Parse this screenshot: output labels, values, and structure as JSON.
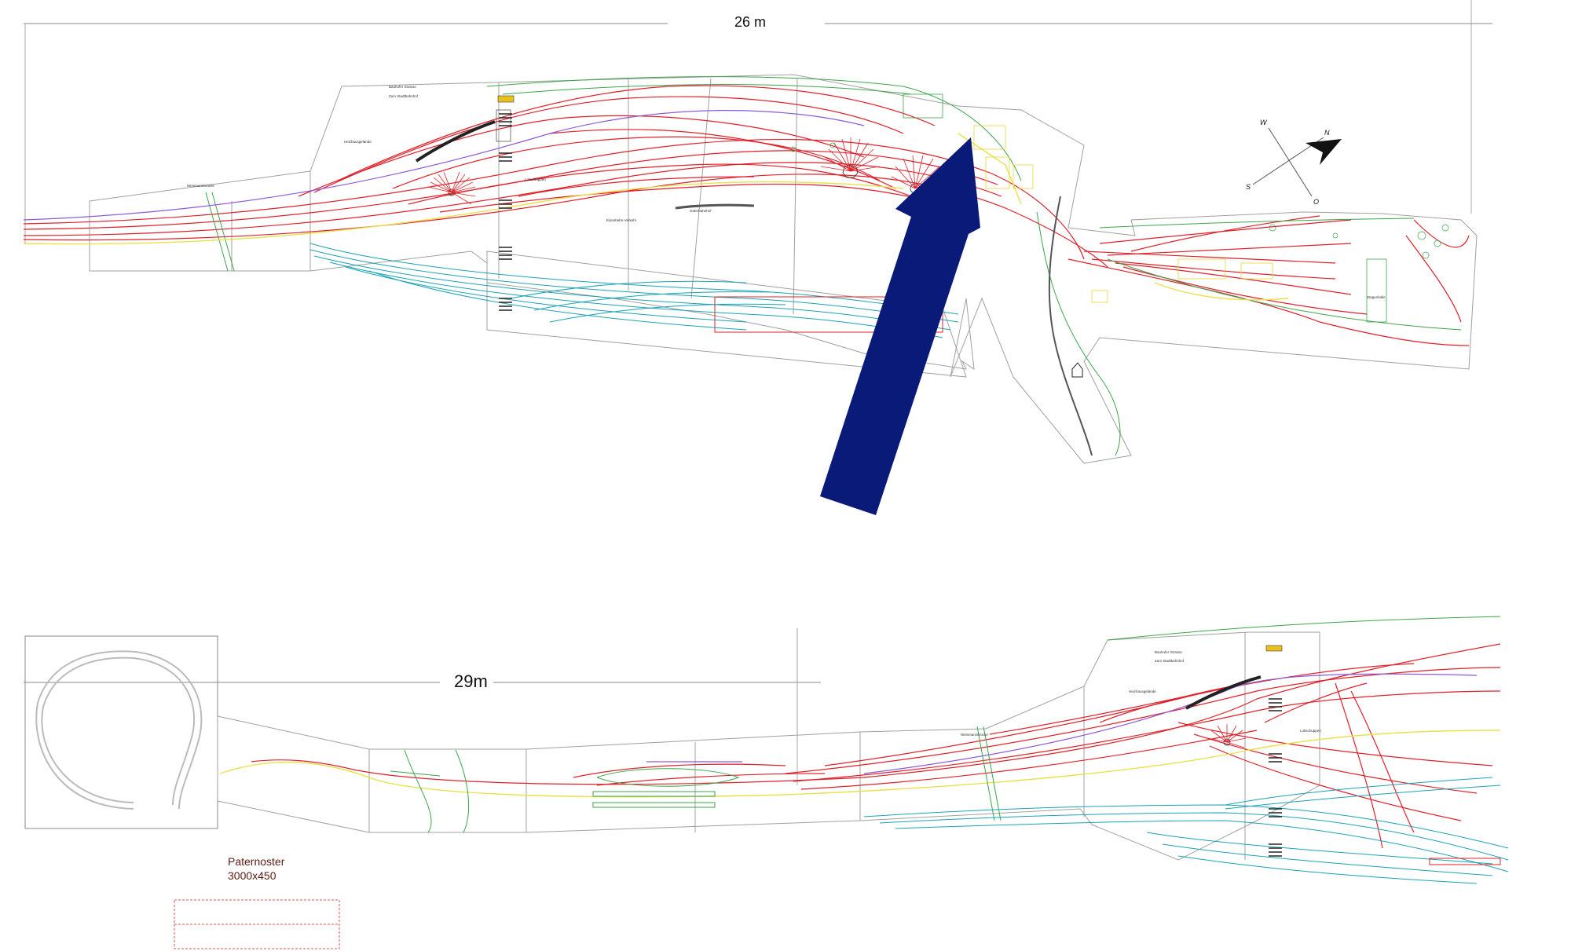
{
  "top_plan": {
    "dimension_label": "26 m",
    "labels": {
      "bridge": "Weinmannbrücke",
      "street1": "Bauhofer Strasse",
      "street2": "Zum Stadtbahnhof",
      "site1": "Heizhausgelände",
      "site2": "Lokschuppen",
      "site3": "Güterbahnhof",
      "site4": "Eisenbahn-Verkehr",
      "depot": "Wagenhalle"
    },
    "compass": {
      "w": "W",
      "n": "N",
      "s": "S",
      "o": "O"
    }
  },
  "bottom_plan": {
    "dimension_label": "29m",
    "labels": {
      "bridge": "Weinmannbrücke",
      "street1": "Bauhofer Strasse",
      "street2": "Zum Stadtbahnhof",
      "site1": "Heizhausgelände",
      "site2": "Lokschuppen"
    }
  },
  "paternoster": {
    "title": "Paternoster",
    "size": "3000x450"
  },
  "colors": {
    "track_main": "#e0202a",
    "track_yard": "#1aa3b5",
    "track_light": "#e8e24a",
    "track_purple": "#8c5ad8",
    "green": "#3aa64a",
    "outline": "#9a9a9a",
    "arrow": "#0a1a78",
    "paternoster_box": "#e05050"
  }
}
